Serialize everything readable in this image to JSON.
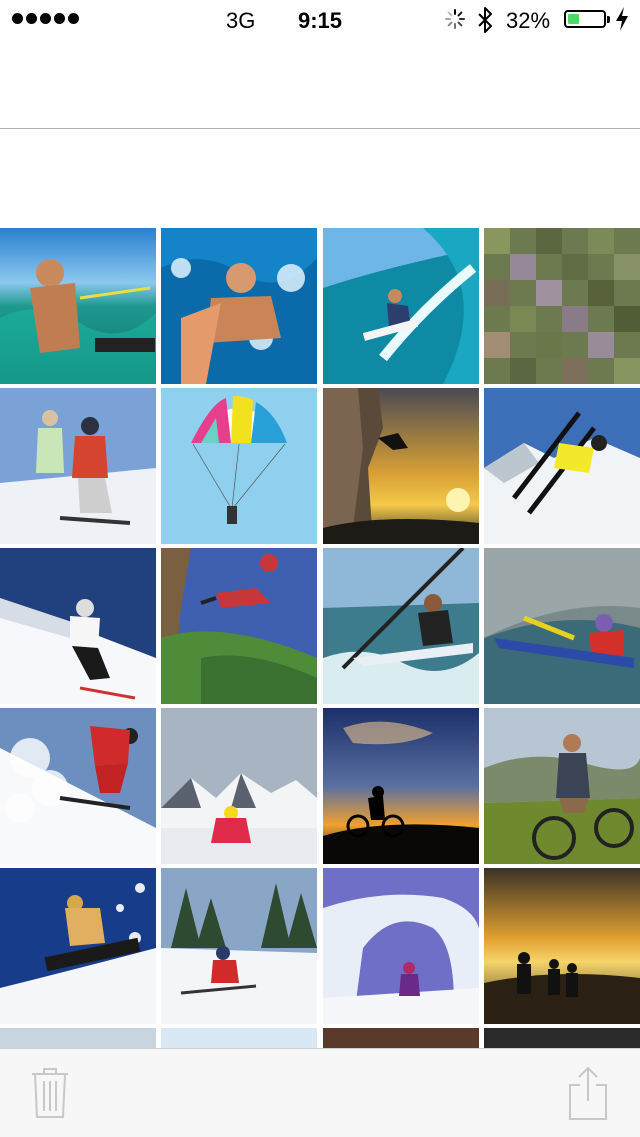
{
  "status_bar": {
    "carrier": "3G",
    "time": "9:15",
    "battery_percent": "32%",
    "battery_level": 0.32,
    "signal_dots": 5,
    "colors": {
      "battery_fill": "#4cd964"
    },
    "icons": [
      "signal-dots-icon",
      "activity-spinner-icon",
      "bluetooth-icon",
      "battery-icon",
      "charging-bolt-icon"
    ]
  },
  "toolbar": {
    "icons": [
      "trash-icon",
      "share-icon"
    ],
    "tint": "#c8c8c8"
  },
  "photos": [
    {
      "subject": "kitesurfer-selfie"
    },
    {
      "subject": "bodyboard-wave"
    },
    {
      "subject": "surfer-barrel"
    },
    {
      "subject": "pixelated-moss"
    },
    {
      "subject": "skiers-pair"
    },
    {
      "subject": "parasail"
    },
    {
      "subject": "rock-climber-sunset"
    },
    {
      "subject": "ski-jump"
    },
    {
      "subject": "downhill-skier"
    },
    {
      "subject": "base-jumper"
    },
    {
      "subject": "kayaker-sea"
    },
    {
      "subject": "kayaker-river"
    },
    {
      "subject": "skier-powder"
    },
    {
      "subject": "skier-mountains"
    },
    {
      "subject": "biker-silhouette"
    },
    {
      "subject": "mountain-biker"
    },
    {
      "subject": "snowboarder-air"
    },
    {
      "subject": "skiers-forest"
    },
    {
      "subject": "snow-arch"
    },
    {
      "subject": "hikers-sunset"
    },
    {
      "subject": "partial-1"
    },
    {
      "subject": "partial-2"
    },
    {
      "subject": "partial-3"
    },
    {
      "subject": "partial-4"
    }
  ]
}
